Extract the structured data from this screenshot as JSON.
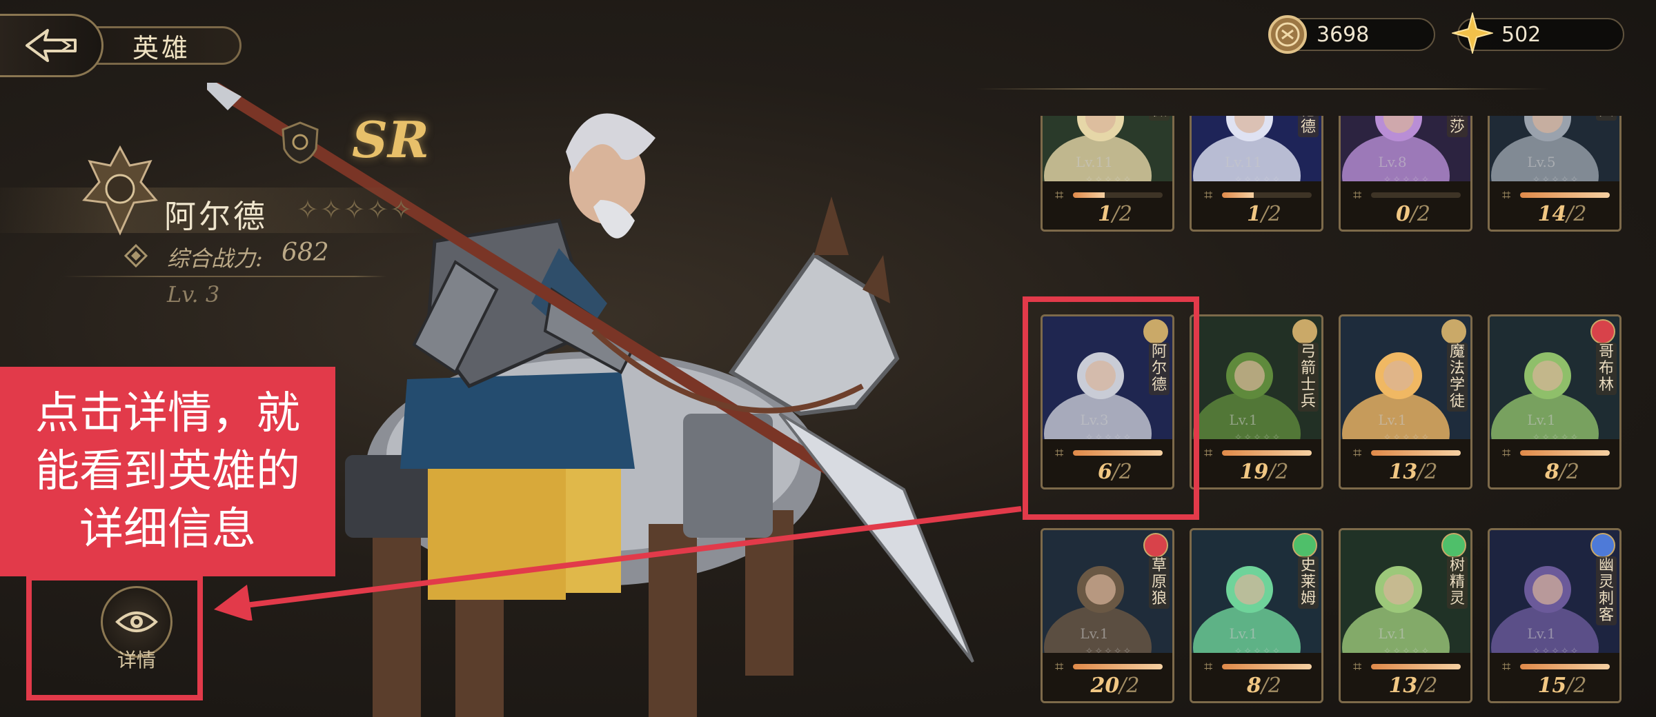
{
  "header": {
    "title": "英雄",
    "back_icon": "back-arrow-icon"
  },
  "currency": [
    {
      "icon": "coin-icon",
      "value": "3698"
    },
    {
      "icon": "star-gem-icon",
      "value": "502"
    }
  ],
  "hero": {
    "rarity": "SR",
    "name": "阿尔德",
    "stars": "✧✧✧✧✧",
    "power_label": "综合战力:",
    "power_value": "682",
    "level": "Lv. 3"
  },
  "annotation": {
    "text": "点击详情，就能看到英雄的详细信息"
  },
  "detail_button": {
    "label": "详情"
  },
  "colors": {
    "accent": "#e23a4a",
    "gold": "#e8c06a",
    "bar": "#e08a4a"
  },
  "heroes": [
    {
      "name": "艾薇",
      "level": "Lv.11",
      "shards": "1",
      "total": "/2",
      "progress": 0.35,
      "faction": "#4fbf6a",
      "bg": "#2a3a2a",
      "skin": "#e6d7a8"
    },
    {
      "name": "维伦德",
      "level": "Lv.11",
      "shards": "1",
      "total": "/2",
      "progress": 0.35,
      "faction": "#4e7ad8",
      "bg": "#1e2458",
      "skin": "#dfe2f2"
    },
    {
      "name": "娜丽莎",
      "level": "Lv.8",
      "shards": "0",
      "total": "/2",
      "progress": 0.0,
      "faction": "#caa968",
      "bg": "#2c2340",
      "skin": "#b98ed6"
    },
    {
      "name": "士兵",
      "level": "Lv.5",
      "shards": "14",
      "total": "/2",
      "progress": 1.0,
      "faction": "#caa968",
      "bg": "#1f2a36",
      "skin": "#9aa2ad"
    },
    {
      "name": "阿尔德",
      "level": "Lv.3",
      "shards": "6",
      "total": "/2",
      "progress": 1.0,
      "faction": "#caa968",
      "bg": "#1f2650",
      "skin": "#c9ccd6"
    },
    {
      "name": "弓箭士兵",
      "level": "Lv.1",
      "shards": "19",
      "total": "/2",
      "progress": 1.0,
      "faction": "#caa968",
      "bg": "#223025",
      "skin": "#5f8a3c"
    },
    {
      "name": "魔法学徒",
      "level": "Lv.1",
      "shards": "13",
      "total": "/2",
      "progress": 1.0,
      "faction": "#caa968",
      "bg": "#1e2c3c",
      "skin": "#f0b863"
    },
    {
      "name": "哥布林",
      "level": "Lv.1",
      "shards": "8",
      "total": "/2",
      "progress": 1.0,
      "faction": "#d8424a",
      "bg": "#1e2c32",
      "skin": "#8fbf6a"
    },
    {
      "name": "草原狼",
      "level": "Lv.1",
      "shards": "20",
      "total": "/2",
      "progress": 1.0,
      "faction": "#d8424a",
      "bg": "#1f2c3a",
      "skin": "#6a5844"
    },
    {
      "name": "史莱姆",
      "level": "Lv.1",
      "shards": "8",
      "total": "/2",
      "progress": 1.0,
      "faction": "#4fbf6a",
      "bg": "#1d2e3a",
      "skin": "#6fd39a"
    },
    {
      "name": "树精灵",
      "level": "Lv.1",
      "shards": "13",
      "total": "/2",
      "progress": 1.0,
      "faction": "#4fbf6a",
      "bg": "#203226",
      "skin": "#9cc87a"
    },
    {
      "name": "幽灵刺客",
      "level": "Lv.1",
      "shards": "15",
      "total": "/2",
      "progress": 1.0,
      "faction": "#4e7ad8",
      "bg": "#1d2440",
      "skin": "#6b5a9a"
    }
  ]
}
